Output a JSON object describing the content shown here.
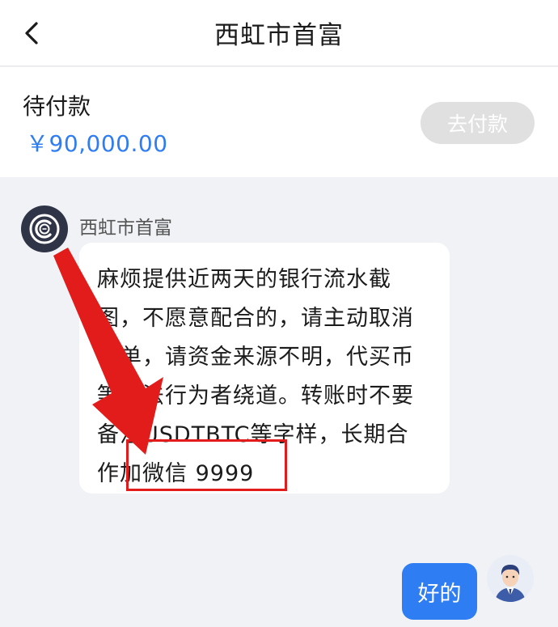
{
  "header": {
    "title": "西虹市首富",
    "back_icon": "chevron-left-icon"
  },
  "order": {
    "status": "待付款",
    "amount": "￥90,000.00",
    "pay_label": "去付款"
  },
  "messages": {
    "incoming": {
      "sender": "西虹市首富",
      "text": "麻烦提供近两天的银行流水截图，不愿意配合的，请主动取消订单，请资金来源不明，代买币等违法行为者绕道。转账时不要备注USDTBTC等字样，长期合作加微信 9999"
    },
    "outgoing": {
      "text": "好的"
    }
  },
  "colors": {
    "accent": "#2f7df3",
    "annotation": "#e21b1b",
    "pay_disabled": "#e0e0e0"
  }
}
